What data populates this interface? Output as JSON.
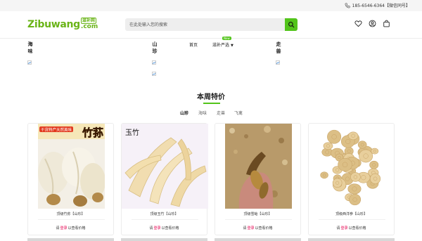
{
  "topbar": {
    "phone": "185-6546-6364【微信同号】"
  },
  "header": {
    "logo_main": "Zibuwang",
    "logo_cn": "滋补网",
    "logo_com": ".com",
    "search_placeholder": "在此处输入您的搜索"
  },
  "categories": {
    "haiwei": "海味",
    "shanzhen": "山珍",
    "zoushou": "走兽"
  },
  "nav": {
    "home": "首页",
    "featured": "滋补严选",
    "featured_badge": "New"
  },
  "section": {
    "title": "本周特价",
    "tabs": [
      "山珍",
      "海味",
      "走兽",
      "飞禽"
    ],
    "active_tab": "山珍"
  },
  "products": [
    {
      "name": "顶级竹荪【山珍】",
      "img_label_top": "干货特产天然美味",
      "img_label_big": "竹荪"
    },
    {
      "name": "顶级玉竹【山珍】",
      "img_label": "玉竹"
    },
    {
      "name": "顶级雪蛤【山珍】"
    },
    {
      "name": "顶级西洋参【山珍】"
    }
  ],
  "price_text": {
    "prefix": "请",
    "login": "登录",
    "suffix": "以查看价格"
  },
  "colors": {
    "brand_green": "#52c41a",
    "logo_green": "#6ab418",
    "login_red": "#e5004f"
  }
}
